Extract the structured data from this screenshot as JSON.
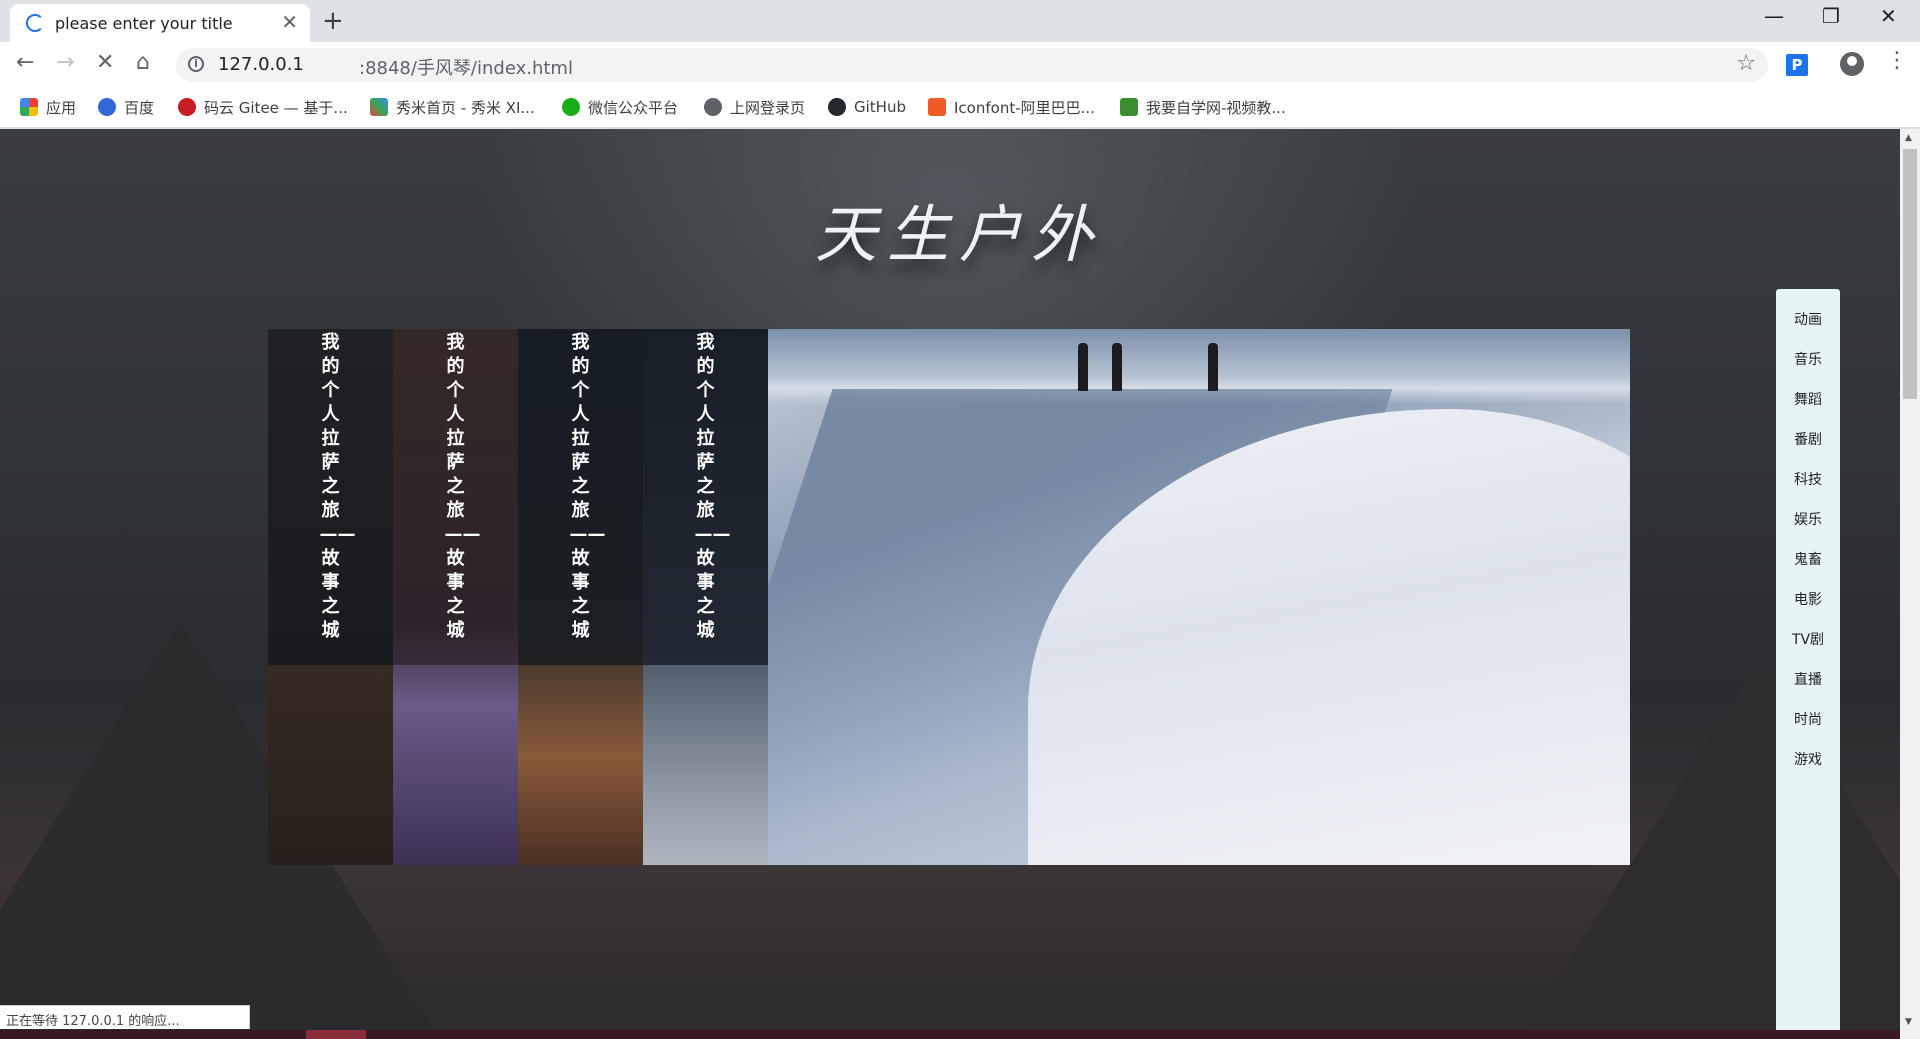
{
  "browser": {
    "tab_title": "please enter your title",
    "tab_close": "✕",
    "new_tab": "+",
    "window_controls": {
      "minimize": "—",
      "maximize": "❐",
      "close": "✕"
    },
    "nav": {
      "back": "←",
      "forward": "→",
      "stop": "✕",
      "home": "⌂"
    },
    "url_host": "127.0.0.1",
    "url_path": ":8848/手风琴/index.html",
    "star": "☆",
    "extension_label": "P",
    "menu": "⋮",
    "status_text": "正在等待 127.0.0.1 的响应..."
  },
  "bookmarks": [
    {
      "label": "应用",
      "icon": "apps-grid-icon",
      "color": "#ea4335"
    },
    {
      "label": "百度",
      "icon": "baidu-paw-icon",
      "color": "#3367d6"
    },
    {
      "label": "码云 Gitee — 基于...",
      "icon": "gitee-icon",
      "color": "#c71d23"
    },
    {
      "label": "秀米首页 - 秀米 XI...",
      "icon": "xiumi-icon",
      "color": "#e8453c"
    },
    {
      "label": "微信公众平台",
      "icon": "wechat-icon",
      "color": "#1aad19"
    },
    {
      "label": "上网登录页",
      "icon": "globe-icon",
      "color": "#5f6368"
    },
    {
      "label": "GitHub",
      "icon": "github-icon",
      "color": "#24292e"
    },
    {
      "label": "Iconfont-阿里巴巴...",
      "icon": "iconfont-icon",
      "color": "#f15a24"
    },
    {
      "label": "我要自学网-视频教...",
      "icon": "zixue-icon",
      "color": "#3c8d2f"
    }
  ],
  "page": {
    "logo_text": "天生户外",
    "panels": [
      {
        "caption": "我的个人拉萨之旅——故事之城"
      },
      {
        "caption": "我的个人拉萨之旅——故事之城"
      },
      {
        "caption": "我的个人拉萨之旅——故事之城"
      },
      {
        "caption": "我的个人拉萨之旅——故事之城"
      }
    ],
    "side_nav": [
      "动画",
      "音乐",
      "舞蹈",
      "番剧",
      "科技",
      "娱乐",
      "鬼畜",
      "电影",
      "TV剧",
      "直播",
      "时尚",
      "游戏"
    ]
  }
}
